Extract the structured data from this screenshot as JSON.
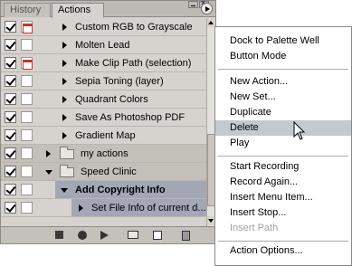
{
  "tabs": {
    "history": "History",
    "actions": "Actions"
  },
  "actions_list": [
    {
      "label": "Custom RGB to Grayscale",
      "checked": true,
      "dialog": true
    },
    {
      "label": "Molten Lead",
      "checked": true,
      "dialog": false
    },
    {
      "label": "Make Clip Path (selection)",
      "checked": true,
      "dialog": true
    },
    {
      "label": "Sepia Toning (layer)",
      "checked": true,
      "dialog": false
    },
    {
      "label": "Quadrant Colors",
      "checked": true,
      "dialog": false
    },
    {
      "label": "Save As Photoshop PDF",
      "checked": true,
      "dialog": false
    },
    {
      "label": "Gradient Map",
      "checked": true,
      "dialog": false
    }
  ],
  "sets": [
    {
      "label": "my actions",
      "expanded": false
    },
    {
      "label": "Speed Clinic",
      "expanded": true
    }
  ],
  "selected_action": "Add Copyright Info",
  "selected_step": "Set File Info of current d...",
  "menu": {
    "group1": [
      "Dock to Palette Well",
      "Button Mode"
    ],
    "group2": [
      "New Action...",
      "New Set...",
      "Duplicate",
      "Delete",
      "Play"
    ],
    "group3": [
      "Start Recording",
      "Record Again...",
      "Insert Menu Item...",
      "Insert Stop...",
      "Insert Path"
    ],
    "group4": [
      "Action Options..."
    ],
    "active_item": "Delete",
    "disabled_item": "Insert Path"
  },
  "colors": {
    "palette_bg": "#d6d3ce",
    "selection": "#a3a6b5",
    "menu_highlight": "#c4c8cf"
  }
}
